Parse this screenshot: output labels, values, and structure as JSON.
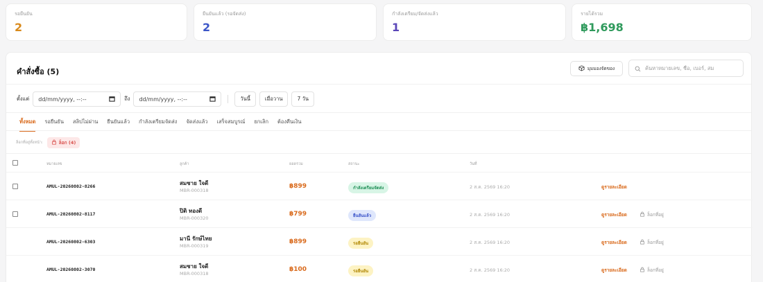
{
  "stats": [
    {
      "label": "รอยืนยัน",
      "value": "2",
      "color": "#d98a1c"
    },
    {
      "label": "ยืนยันแล้ว (รอจัดส่ง)",
      "value": "2",
      "color": "#3b55c7"
    },
    {
      "label": "กำลังเตรียม/จัดส่งแล้ว",
      "value": "1",
      "color": "#5a46b8"
    },
    {
      "label": "รายได้รวม",
      "value": "฿1,698",
      "color": "#2f9a5c"
    }
  ],
  "orders_panel": {
    "title": "คำสั่งซื้อ (5)",
    "pack_view_label": "มุมมองจัดของ",
    "search_placeholder": "ค้นหาหมายเลข, ชื่อ, เบอร์, สม"
  },
  "filter": {
    "from_label": "ตั้งแต่",
    "to_label": "ถึง",
    "date_placeholder": "dd/mm/yyyy, --:--",
    "quick_buttons": [
      "วันนี้",
      "เมื่อวาน",
      "7 วัน"
    ]
  },
  "tabs": [
    "ทั้งหมด",
    "รอยืนยัน",
    "สลิปไม่ผ่าน",
    "ยืนยันแล้ว",
    "กำลังเตรียมจัดส่ง",
    "จัดส่งแล้ว",
    "เสร็จสมบูรณ์",
    "ยกเลิก",
    "ต้องคืนเงิน"
  ],
  "active_tab": "ทั้งหมด",
  "locked": {
    "label": "ล็อกที่อยู่ทั้งหน้า:",
    "badge": "ล็อก (4)"
  },
  "table": {
    "headers": [
      "หมายเลข",
      "ลูกค้า",
      "ยอดรวม",
      "สถานะ",
      "วันที่"
    ],
    "rows": [
      {
        "order_no": "AMUL-20260802-8266",
        "customer": "สมชาย ใจดี",
        "member_id": "MBR-000318",
        "total": "฿899",
        "status": "กำลังเตรียมจัดส่ง",
        "status_type": "preparing",
        "date": "2 ส.ค. 2569 16:20",
        "detail": "ดูรายละเอียด",
        "lock": "",
        "has_checkbox": true
      },
      {
        "order_no": "AMUL-20260802-8117",
        "customer": "ปิติ ทองดี",
        "member_id": "MBR-000320",
        "total": "฿799",
        "status": "ยืนยันแล้ว",
        "status_type": "confirmed",
        "date": "2 ส.ค. 2569 16:20",
        "detail": "ดูรายละเอียด",
        "lock": "ล็อกที่อยู่",
        "has_checkbox": true
      },
      {
        "order_no": "AMUL-20260802-6303",
        "customer": "มานี รักษ์ไทย",
        "member_id": "MBR-000319",
        "total": "฿899",
        "status": "รอยืนยัน",
        "status_type": "pending",
        "date": "2 ส.ค. 2569 16:20",
        "detail": "ดูรายละเอียด",
        "lock": "ล็อกที่อยู่",
        "has_checkbox": false
      },
      {
        "order_no": "AMUL-20260802-3070",
        "customer": "สมชาย ใจดี",
        "member_id": "MBR-000318",
        "total": "฿100",
        "status": "รอยืนยัน",
        "status_type": "pending",
        "date": "2 ส.ค. 2569 16:20",
        "detail": "ดูรายละเอียด",
        "lock": "ล็อกที่อยู่",
        "has_checkbox": false
      }
    ]
  },
  "colors": {
    "accent": "#d96a1c",
    "locked_red": "#d9534f"
  }
}
